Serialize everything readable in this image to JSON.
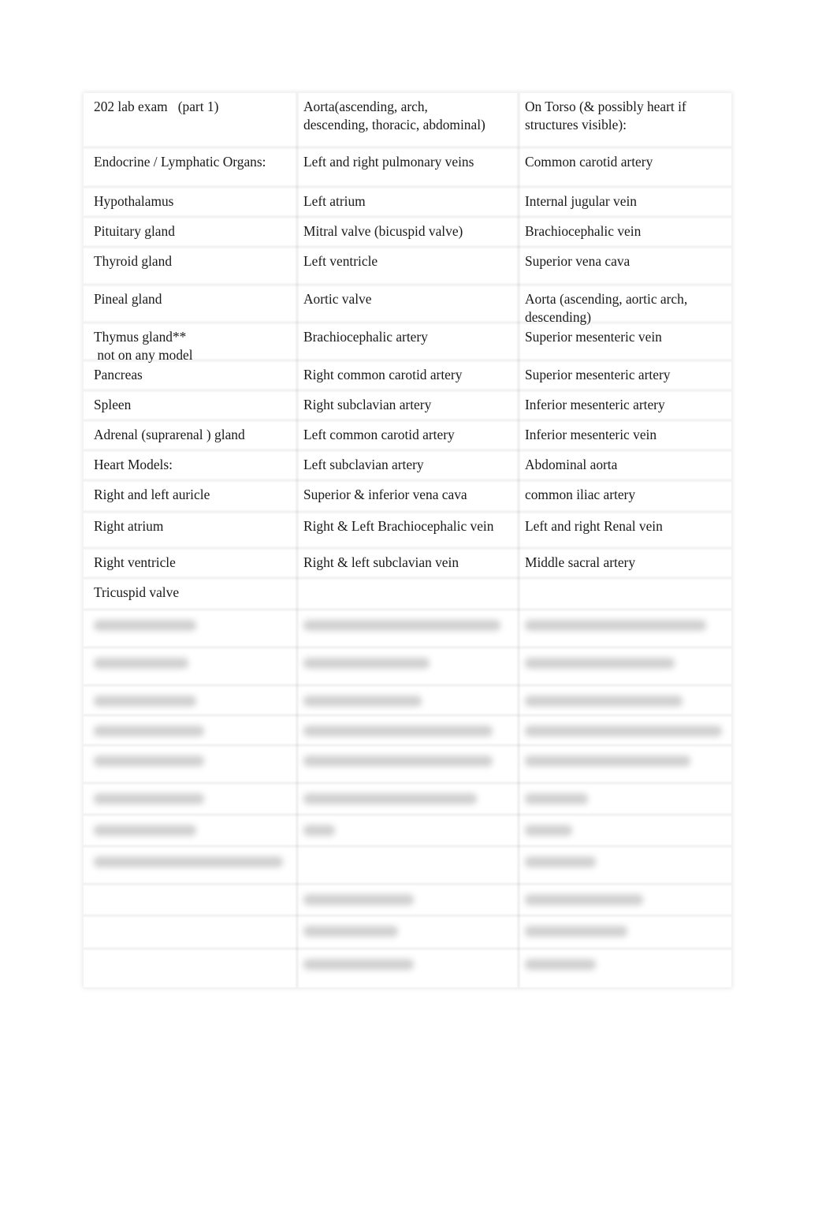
{
  "document": {
    "title": "202 lab exam   (part 1)",
    "columns": 3,
    "rows": [
      [
        "202 lab exam   (part 1)",
        "Aorta(ascending, arch,\ndescending, thoracic, abdominal)",
        "On Torso (& possibly heart if\nstructures visible):"
      ],
      [
        "Endocrine / Lymphatic Organs:",
        "Left and right pulmonary veins",
        "Common carotid artery"
      ],
      [
        "Hypothalamus",
        "Left atrium",
        "Internal jugular vein"
      ],
      [
        "Pituitary gland",
        "Mitral valve (bicuspid valve)",
        "Brachiocephalic vein"
      ],
      [
        "Thyroid gland",
        "Left ventricle",
        "Superior vena cava"
      ],
      [
        "Pineal gland",
        "Aortic valve",
        "Aorta (ascending, aortic arch,\ndescending)"
      ],
      [
        "Thymus gland**\n not on any model",
        "Brachiocephalic artery",
        "Superior mesenteric vein"
      ],
      [
        "Pancreas",
        "Right common carotid artery",
        "Superior mesenteric artery"
      ],
      [
        "Spleen",
        "Right subclavian artery",
        "Inferior mesenteric artery"
      ],
      [
        "Adrenal (suprarenal ) gland",
        "Left common carotid artery",
        "Inferior mesenteric vein"
      ],
      [
        "Heart Models:",
        "Left subclavian artery",
        "Abdominal aorta"
      ],
      [
        "Right and left auricle",
        "Superior & inferior vena cava",
        "common iliac artery"
      ],
      [
        "Right atrium",
        "Right & Left Brachiocephalic vein",
        "Left and right Renal vein"
      ],
      [
        "Right ventricle",
        "Right & left subclavian vein",
        "Middle sacral artery"
      ],
      [
        "Tricuspid valve",
        "",
        ""
      ]
    ],
    "blurred_rows_count": 11,
    "blurred_note": "Remaining rows are obscured (blurred) and unreadable"
  }
}
